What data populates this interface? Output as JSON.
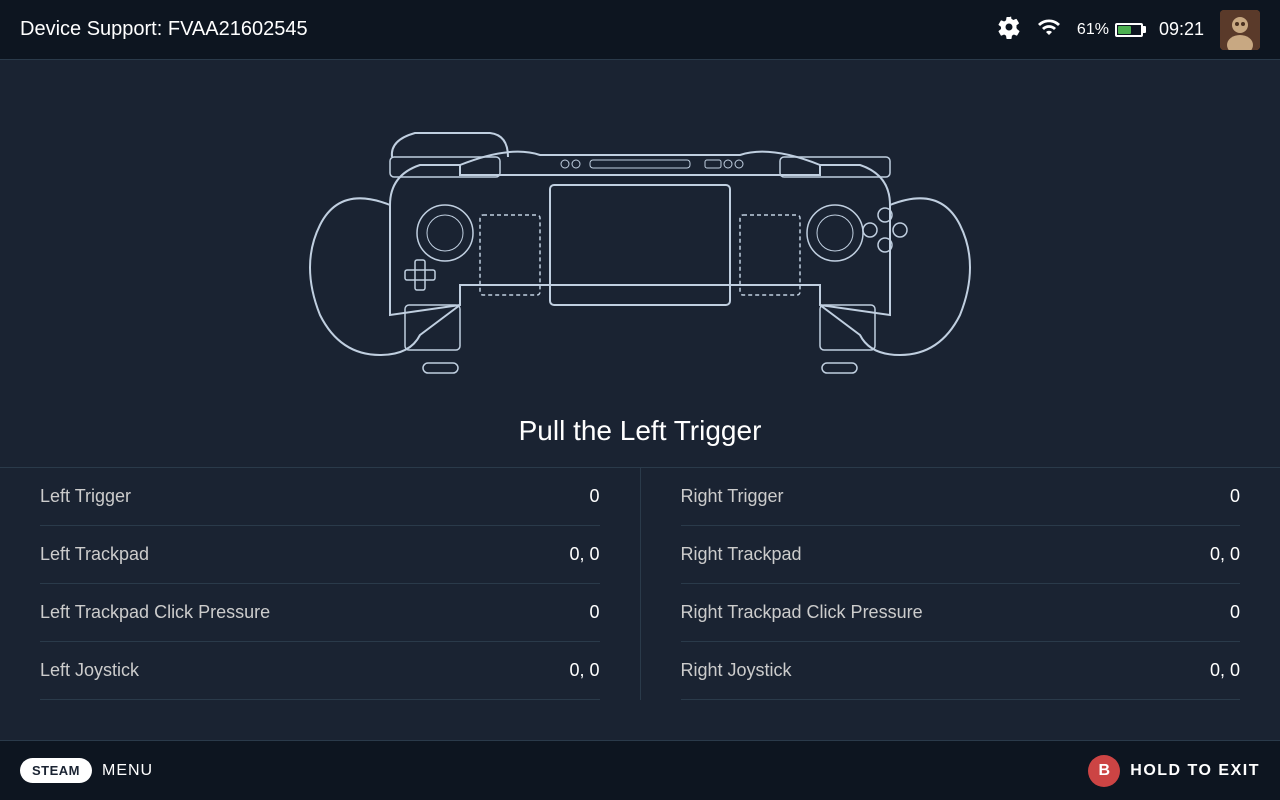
{
  "header": {
    "title": "Device Support: FVAA21602545",
    "battery_percent": "61%",
    "time": "09:21"
  },
  "instruction": {
    "text": "Pull the Left Trigger"
  },
  "data": {
    "left_column": [
      {
        "label": "Left Trigger",
        "value": "0"
      },
      {
        "label": "Left Trackpad",
        "value": "0, 0"
      },
      {
        "label": "Left Trackpad Click Pressure",
        "value": "0"
      },
      {
        "label": "Left Joystick",
        "value": "0, 0"
      }
    ],
    "right_column": [
      {
        "label": "Right Trigger",
        "value": "0"
      },
      {
        "label": "Right Trackpad",
        "value": "0, 0"
      },
      {
        "label": "Right Trackpad Click Pressure",
        "value": "0"
      },
      {
        "label": "Right Joystick",
        "value": "0, 0"
      }
    ]
  },
  "footer": {
    "steam_label": "STEAM",
    "menu_label": "MENU",
    "hold_exit_label": "HOLD TO EXIT",
    "b_button_label": "B"
  }
}
